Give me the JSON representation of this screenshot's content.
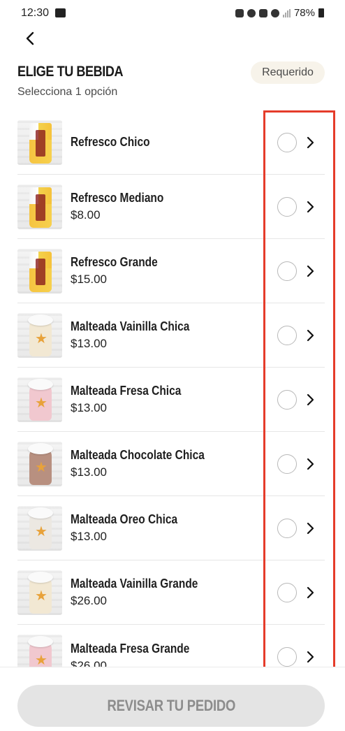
{
  "status_bar": {
    "time": "12:30",
    "battery": "78%"
  },
  "header": {
    "title": "ELIGE TU BEBIDA",
    "subtitle": "Selecciona 1 opción",
    "badge": "Requerido"
  },
  "items": [
    {
      "name": "Refresco Chico",
      "price": "",
      "image": "soda-cup"
    },
    {
      "name": "Refresco Mediano",
      "price": "$8.00",
      "image": "soda-cup"
    },
    {
      "name": "Refresco Grande",
      "price": "$15.00",
      "image": "soda-cup"
    },
    {
      "name": "Malteada Vainilla Chica",
      "price": "$13.00",
      "image": "vanilla-shake"
    },
    {
      "name": "Malteada Fresa Chica",
      "price": "$13.00",
      "image": "strawberry-shake"
    },
    {
      "name": "Malteada Chocolate Chica",
      "price": "$13.00",
      "image": "chocolate-shake"
    },
    {
      "name": "Malteada Oreo Chica",
      "price": "$13.00",
      "image": "oreo-shake"
    },
    {
      "name": "Malteada Vainilla Grande",
      "price": "$26.00",
      "image": "vanilla-shake"
    },
    {
      "name": "Malteada Fresa Grande",
      "price": "$26.00",
      "image": "strawberry-shake"
    }
  ],
  "footer": {
    "cta_label": "REVISAR TU PEDIDO"
  },
  "colors": {
    "highlight": "#e53c2a",
    "badge_bg": "#f7f3ea",
    "cta_bg": "#e4e4e4"
  }
}
